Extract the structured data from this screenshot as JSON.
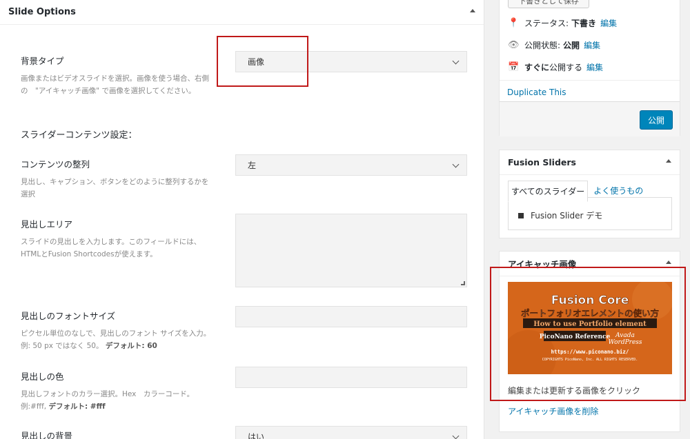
{
  "main": {
    "title": "Slide Options",
    "section_heading": "スライダーコンテンツ設定：",
    "fields": {
      "bg_type": {
        "label": "背景タイプ",
        "desc": "画像またはビデオスライドを選択。画像を使う場合、右側の　\"アイキャッチ画像\" で画像を選択してください。",
        "value": "画像"
      },
      "alignment": {
        "label": "コンテンツの整列",
        "desc": "見出し、キャプション、ボタンをどのように整列するかを選択",
        "value": "左"
      },
      "heading_area": {
        "label": "見出しエリア",
        "desc": "スライドの見出しを入力します。このフィールドには、HTMLとFusion Shortcodesが使えます。"
      },
      "heading_font_size": {
        "label": "見出しのフォントサイズ",
        "desc": "ピクセル単位のなしで、見出しのフォント サイズを入力。例: 50 px ではなく 50。",
        "default_label": "デフォルト: 60"
      },
      "heading_color": {
        "label": "見出しの色",
        "desc": "見出しフォントのカラー選択。Hex　カラーコード。例:#fff,",
        "default_label": "デフォルト: #fff"
      },
      "heading_bg": {
        "label": "見出しの背景",
        "value": "はい"
      }
    }
  },
  "publish": {
    "draft_button": "下書きとして保存",
    "status_label": "ステータス:",
    "status_value": "下書き",
    "visibility_label": "公開状態:",
    "visibility_value": "公開",
    "schedule_strong": "すぐに",
    "schedule_text": "公開する",
    "edit_link": "編集",
    "duplicate_link": "Duplicate This",
    "publish_button": "公開"
  },
  "sliders": {
    "title": "Fusion Sliders",
    "tab_all": "すべてのスライダー",
    "tab_popular": "よく使うもの",
    "items": [
      "Fusion Slider デモ"
    ]
  },
  "featured": {
    "title": "アイキャッチ画像",
    "image_text": {
      "line1": "Fusion Core",
      "line2": "ポートフォリオエレメントの使い方",
      "line3": "How to use Portfolio element",
      "line4": "PicoNano Reference",
      "line5a": "Avada",
      "line5b": "WordPress",
      "line6": "https://www.piconano.biz/",
      "line7": "COPYRIGHTS PicoNano, Inc. ALL RIGHTS RESERVED."
    },
    "click_text": "編集または更新する画像をクリック",
    "remove_link": "アイキャッチ画像を削除"
  },
  "colors": {
    "accent": "#0073aa",
    "publish": "#0085ba",
    "highlight": "#c01818",
    "thumb_bg": "#d96a1e"
  }
}
